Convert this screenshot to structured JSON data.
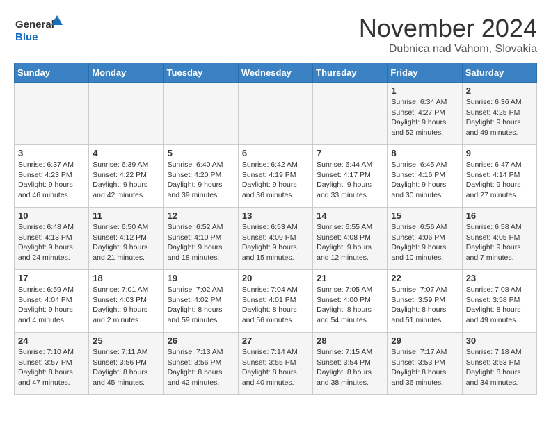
{
  "header": {
    "logo_general": "General",
    "logo_blue": "Blue",
    "month_title": "November 2024",
    "location": "Dubnica nad Vahom, Slovakia"
  },
  "days_of_week": [
    "Sunday",
    "Monday",
    "Tuesday",
    "Wednesday",
    "Thursday",
    "Friday",
    "Saturday"
  ],
  "weeks": [
    [
      {
        "day": "",
        "info": ""
      },
      {
        "day": "",
        "info": ""
      },
      {
        "day": "",
        "info": ""
      },
      {
        "day": "",
        "info": ""
      },
      {
        "day": "",
        "info": ""
      },
      {
        "day": "1",
        "info": "Sunrise: 6:34 AM\nSunset: 4:27 PM\nDaylight: 9 hours\nand 52 minutes."
      },
      {
        "day": "2",
        "info": "Sunrise: 6:36 AM\nSunset: 4:25 PM\nDaylight: 9 hours\nand 49 minutes."
      }
    ],
    [
      {
        "day": "3",
        "info": "Sunrise: 6:37 AM\nSunset: 4:23 PM\nDaylight: 9 hours\nand 46 minutes."
      },
      {
        "day": "4",
        "info": "Sunrise: 6:39 AM\nSunset: 4:22 PM\nDaylight: 9 hours\nand 42 minutes."
      },
      {
        "day": "5",
        "info": "Sunrise: 6:40 AM\nSunset: 4:20 PM\nDaylight: 9 hours\nand 39 minutes."
      },
      {
        "day": "6",
        "info": "Sunrise: 6:42 AM\nSunset: 4:19 PM\nDaylight: 9 hours\nand 36 minutes."
      },
      {
        "day": "7",
        "info": "Sunrise: 6:44 AM\nSunset: 4:17 PM\nDaylight: 9 hours\nand 33 minutes."
      },
      {
        "day": "8",
        "info": "Sunrise: 6:45 AM\nSunset: 4:16 PM\nDaylight: 9 hours\nand 30 minutes."
      },
      {
        "day": "9",
        "info": "Sunrise: 6:47 AM\nSunset: 4:14 PM\nDaylight: 9 hours\nand 27 minutes."
      }
    ],
    [
      {
        "day": "10",
        "info": "Sunrise: 6:48 AM\nSunset: 4:13 PM\nDaylight: 9 hours\nand 24 minutes."
      },
      {
        "day": "11",
        "info": "Sunrise: 6:50 AM\nSunset: 4:12 PM\nDaylight: 9 hours\nand 21 minutes."
      },
      {
        "day": "12",
        "info": "Sunrise: 6:52 AM\nSunset: 4:10 PM\nDaylight: 9 hours\nand 18 minutes."
      },
      {
        "day": "13",
        "info": "Sunrise: 6:53 AM\nSunset: 4:09 PM\nDaylight: 9 hours\nand 15 minutes."
      },
      {
        "day": "14",
        "info": "Sunrise: 6:55 AM\nSunset: 4:08 PM\nDaylight: 9 hours\nand 12 minutes."
      },
      {
        "day": "15",
        "info": "Sunrise: 6:56 AM\nSunset: 4:06 PM\nDaylight: 9 hours\nand 10 minutes."
      },
      {
        "day": "16",
        "info": "Sunrise: 6:58 AM\nSunset: 4:05 PM\nDaylight: 9 hours\nand 7 minutes."
      }
    ],
    [
      {
        "day": "17",
        "info": "Sunrise: 6:59 AM\nSunset: 4:04 PM\nDaylight: 9 hours\nand 4 minutes."
      },
      {
        "day": "18",
        "info": "Sunrise: 7:01 AM\nSunset: 4:03 PM\nDaylight: 9 hours\nand 2 minutes."
      },
      {
        "day": "19",
        "info": "Sunrise: 7:02 AM\nSunset: 4:02 PM\nDaylight: 8 hours\nand 59 minutes."
      },
      {
        "day": "20",
        "info": "Sunrise: 7:04 AM\nSunset: 4:01 PM\nDaylight: 8 hours\nand 56 minutes."
      },
      {
        "day": "21",
        "info": "Sunrise: 7:05 AM\nSunset: 4:00 PM\nDaylight: 8 hours\nand 54 minutes."
      },
      {
        "day": "22",
        "info": "Sunrise: 7:07 AM\nSunset: 3:59 PM\nDaylight: 8 hours\nand 51 minutes."
      },
      {
        "day": "23",
        "info": "Sunrise: 7:08 AM\nSunset: 3:58 PM\nDaylight: 8 hours\nand 49 minutes."
      }
    ],
    [
      {
        "day": "24",
        "info": "Sunrise: 7:10 AM\nSunset: 3:57 PM\nDaylight: 8 hours\nand 47 minutes."
      },
      {
        "day": "25",
        "info": "Sunrise: 7:11 AM\nSunset: 3:56 PM\nDaylight: 8 hours\nand 45 minutes."
      },
      {
        "day": "26",
        "info": "Sunrise: 7:13 AM\nSunset: 3:56 PM\nDaylight: 8 hours\nand 42 minutes."
      },
      {
        "day": "27",
        "info": "Sunrise: 7:14 AM\nSunset: 3:55 PM\nDaylight: 8 hours\nand 40 minutes."
      },
      {
        "day": "28",
        "info": "Sunrise: 7:15 AM\nSunset: 3:54 PM\nDaylight: 8 hours\nand 38 minutes."
      },
      {
        "day": "29",
        "info": "Sunrise: 7:17 AM\nSunset: 3:53 PM\nDaylight: 8 hours\nand 36 minutes."
      },
      {
        "day": "30",
        "info": "Sunrise: 7:18 AM\nSunset: 3:53 PM\nDaylight: 8 hours\nand 34 minutes."
      }
    ]
  ]
}
